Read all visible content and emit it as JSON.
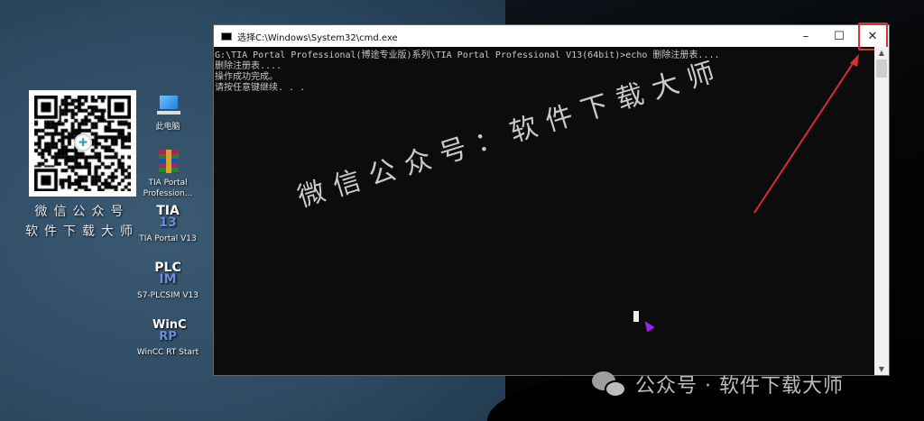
{
  "desktop": {
    "qr_caption": [
      "微信公众号",
      "软件下载大师"
    ],
    "icons": [
      {
        "label": "此电脑",
        "icon": "computer-icon"
      },
      {
        "label": "TIA Portal Profession...",
        "icon": "winrar-archive-icon"
      },
      {
        "label": "TIA Portal V13",
        "icon": "tia-portal-icon",
        "glyph_top": "TIA",
        "glyph_bottom": "13"
      },
      {
        "label": "S7-PLCSIM V13",
        "icon": "plcsim-icon",
        "glyph_top": "PLC",
        "glyph_bottom": "IM"
      },
      {
        "label": "WinCC RT Start",
        "icon": "wincc-icon",
        "glyph_top": "WinC",
        "glyph_bottom": "RP"
      }
    ]
  },
  "window": {
    "title": "选择C:\\Windows\\System32\\cmd.exe",
    "minimize": "–",
    "maximize": "☐",
    "close": "✕",
    "lines": [
      "G:\\TIA Portal Professional(博途专业版)系列\\TIA Portal Professional V13(64bit)>echo 删除注册表....",
      "删除注册表....",
      "操作成功完成。",
      "请按任意键继续. . ."
    ]
  },
  "watermark": "微信公众号：软件下载大师",
  "footer": {
    "text": "公众号 · 软件下载大师"
  },
  "colors": {
    "highlight": "#e03030",
    "desktop": "#2c4a62"
  }
}
